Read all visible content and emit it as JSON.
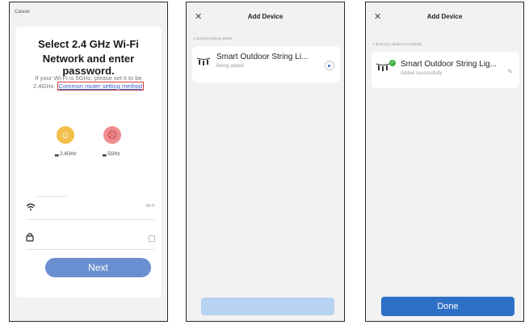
{
  "screen1": {
    "cancel": "Cancel",
    "heading_line1": "Select 2.4 GHz Wi-Fi",
    "heading_line2": "Network and enter password.",
    "hint_line1": "If your Wi-Fi is 5GHz, please set it to be",
    "hint_prefix": "2.4GHz.",
    "hint_link": "Common router setting method",
    "band_ok": "2.4GHz",
    "band_bad": "5GHz",
    "wifi_action": "Wi-Fi",
    "next_button": "Next"
  },
  "screen2": {
    "title": "Add Device",
    "status": "1 device(s) being added",
    "device_name": "Smart Outdoor String Li...",
    "device_sub": "Being added"
  },
  "screen3": {
    "title": "Add Device",
    "status": "1 device(s) added successfully",
    "device_name": "Smart Outdoor String Lig...",
    "device_sub": "Added successfully",
    "done_button": "Done"
  },
  "icons": {
    "close": "close-icon",
    "wifi": "wifi-icon",
    "lock": "lock-icon",
    "bulbs": "string-lights-icon",
    "check": "check-icon",
    "edit": "edit-icon"
  },
  "colors": {
    "accent": "#2e6fc6",
    "next_button": "#6a8fd1",
    "link": "#3b63c8",
    "success": "#3cb043"
  }
}
